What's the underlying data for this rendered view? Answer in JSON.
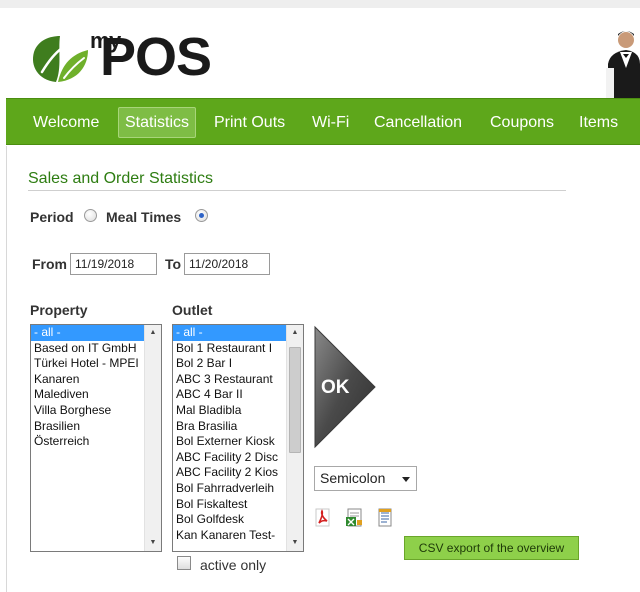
{
  "brand": {
    "logo_my": "my",
    "logo_pos": "POS"
  },
  "nav": {
    "items": [
      {
        "label": "Welcome"
      },
      {
        "label": "Statistics"
      },
      {
        "label": "Print Outs"
      },
      {
        "label": "Wi-Fi"
      },
      {
        "label": "Cancellation"
      },
      {
        "label": "Coupons"
      },
      {
        "label": "Items"
      }
    ],
    "active": "Statistics"
  },
  "page": {
    "title": "Sales and Order Statistics",
    "period_label": "Period",
    "meal_times_label": "Meal Times",
    "mode_selected": "Meal Times",
    "from_label": "From",
    "from_value": "11/19/2018",
    "to_label": "To",
    "to_value": "11/20/2018",
    "property_label": "Property",
    "outlet_label": "Outlet",
    "property_options": [
      "- all -",
      "Based on IT GmbH",
      "Türkei Hotel - MPEI",
      "Kanaren",
      "Malediven",
      "Villa Borghese",
      "Brasilien",
      "Österreich"
    ],
    "outlet_options": [
      "- all -",
      "Bol 1 Restaurant I",
      "Bol 2 Bar I",
      "ABC 3 Restaurant",
      "ABC 4 Bar II",
      "Mal Bladibla",
      "Bra Brasilia",
      "Bol Externer Kiosk",
      "ABC Facility 2 Disc",
      "ABC Facility 2 Kios",
      "Bol Fahrradverleih",
      "Bol Fiskaltest",
      "Bol Golfdesk",
      "Kan Kanaren Test-"
    ],
    "selected_property": "- all -",
    "selected_outlet": "- all -",
    "ok_label": "OK",
    "separator_value": "Semicolon",
    "csv_export_label": "CSV export of the overview",
    "active_only_label": "active only",
    "active_only_checked": false
  },
  "icons": {
    "pdf": "pdf-icon",
    "excel": "excel-icon",
    "text": "text-file-icon",
    "logo": "leaf-logo-icon",
    "waiter": "waiter-avatar-icon"
  },
  "colors": {
    "nav_bg": "#5ea71b",
    "nav_active": "#7ebd45",
    "title_green": "#2e7d12",
    "list_selection": "#3399ff",
    "csv_button": "#8ed04a",
    "ok_button": "#4a4a4a"
  }
}
